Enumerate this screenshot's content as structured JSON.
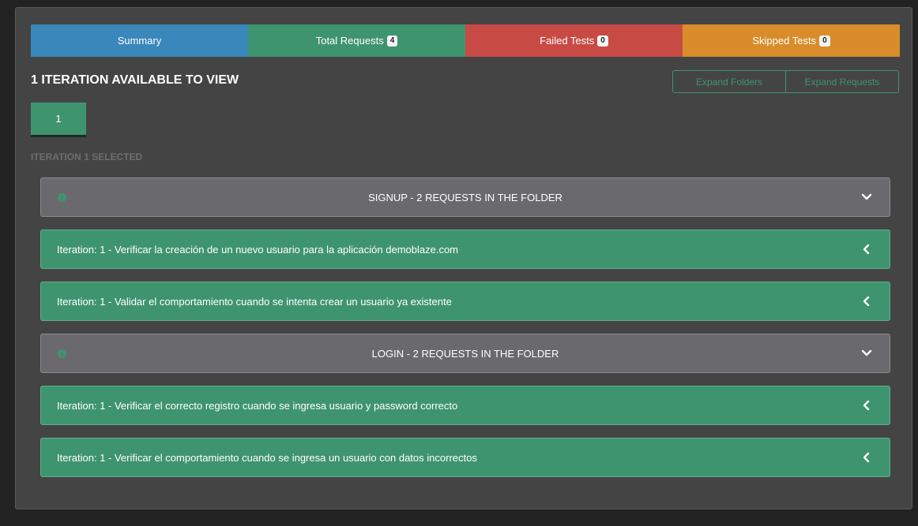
{
  "tabs": {
    "summary": "Summary",
    "total_requests": "Total Requests",
    "total_requests_count": "4",
    "failed_tests": "Failed Tests",
    "failed_tests_count": "0",
    "skipped_tests": "Skipped Tests",
    "skipped_tests_count": "0"
  },
  "iterations": {
    "heading": "1 ITERATION AVAILABLE TO VIEW",
    "expand_folders": "Expand Folders",
    "expand_requests": "Expand Requests",
    "buttons": [
      "1"
    ],
    "selected_text": "ITERATION 1 SELECTED"
  },
  "rows": [
    {
      "kind": "folder",
      "title": "SIGNUP - 2 REQUESTS IN THE FOLDER",
      "icon": "info-icon",
      "expanded_icon": "chevron-down-icon"
    },
    {
      "kind": "request",
      "title": "Iteration: 1 - Verificar la creación de un nuevo usuario para la aplicación demoblaze.com",
      "expanded_icon": "chevron-left-icon"
    },
    {
      "kind": "request",
      "title": "Iteration: 1 - Validar el comportamiento cuando se intenta crear un usuario ya existente",
      "expanded_icon": "chevron-left-icon"
    },
    {
      "kind": "folder",
      "title": "LOGIN - 2 REQUESTS IN THE FOLDER",
      "icon": "info-icon",
      "expanded_icon": "chevron-down-icon"
    },
    {
      "kind": "request",
      "title": "Iteration: 1 - Verificar el correcto registro cuando se ingresa usuario y password correcto",
      "expanded_icon": "chevron-left-icon"
    },
    {
      "kind": "request",
      "title": "Iteration: 1 - Verificar el comportamiento cuando se ingresa un usuario con datos incorrectos",
      "expanded_icon": "chevron-left-icon"
    }
  ],
  "colors": {
    "summary": "#3a87bb",
    "total": "#3f9470",
    "failed": "#c74b44",
    "skipped": "#d88d2a",
    "folder": "#6a6a6e",
    "request": "#3f9470"
  }
}
